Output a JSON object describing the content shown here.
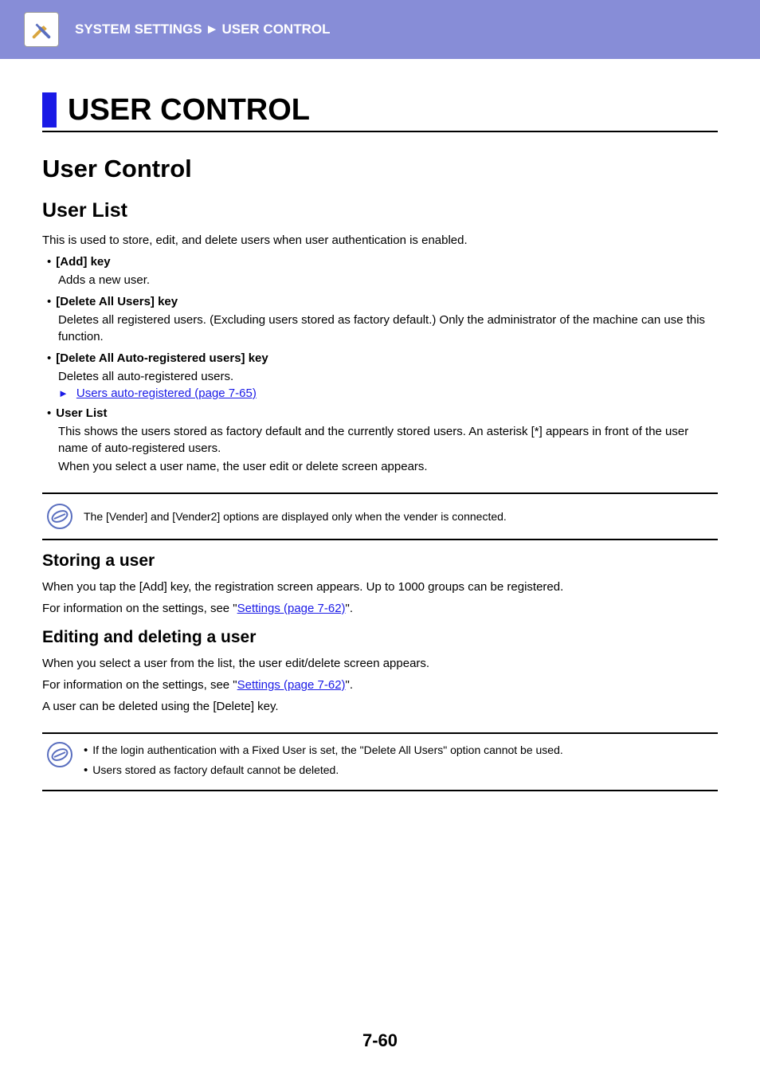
{
  "header": {
    "breadcrumb1": "SYSTEM SETTINGS",
    "arrow": "►",
    "breadcrumb2": "USER CONTROL"
  },
  "pageTitle": "USER CONTROL",
  "s1": {
    "h1": "User Control",
    "h2": "User List",
    "intro": "This is used to store, edit, and delete users when user authentication is enabled.",
    "items": [
      {
        "label": "[Add] key",
        "desc": "Adds a new user."
      },
      {
        "label": "[Delete All Users] key",
        "desc": "Deletes all registered users. (Excluding users stored as factory default.) Only the administrator of the machine can use this function."
      },
      {
        "label": "[Delete All Auto-registered users] key",
        "desc": "Deletes all auto-registered users.",
        "xref": "Users auto-registered (page 7-65)"
      },
      {
        "label": "User List",
        "desc": "This shows the users stored as factory default and the currently stored users. An asterisk [*] appears in front of the user name of auto-registered users.",
        "desc2": "When you select a user name, the user edit or delete screen appears."
      }
    ],
    "note1": "The [Vender] and [Vender2] options are displayed only when the vender is connected."
  },
  "s2": {
    "h3": "Storing a user",
    "p1": "When you tap the [Add] key, the registration screen appears. Up to 1000 groups can be registered.",
    "p2a": "For information on the settings, see \"",
    "p2link": "Settings (page 7-62)",
    "p2b": "\"."
  },
  "s3": {
    "h3": "Editing and deleting a user",
    "p1": "When you select a user from the list, the user edit/delete screen appears.",
    "p2a": "For information on the settings, see \"",
    "p2link": "Settings (page 7-62)",
    "p2b": "\".",
    "p3": "A user can be deleted using the [Delete] key.",
    "note": [
      "If the login authentication with a Fixed User is set, the \"Delete All Users\" option cannot be used.",
      "Users stored as factory default cannot be deleted."
    ]
  },
  "pageNumber": "7-60"
}
